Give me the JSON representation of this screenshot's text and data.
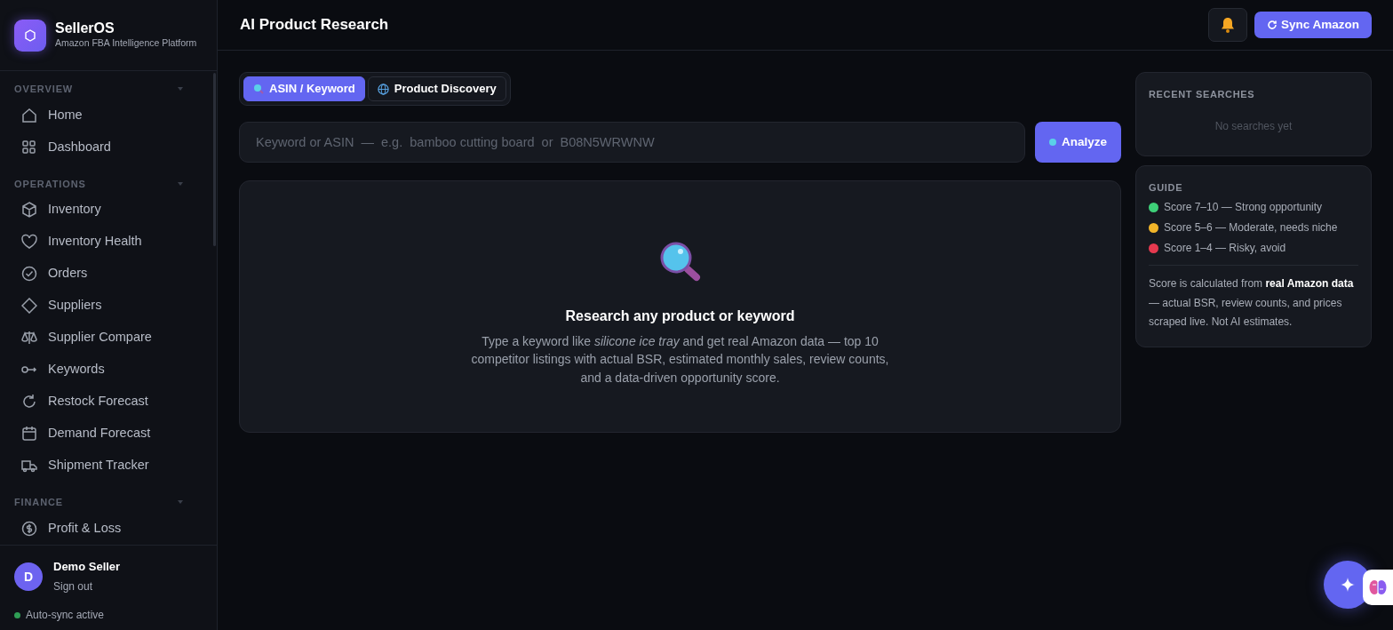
{
  "brand": {
    "name": "SellerOS",
    "tagline": "Amazon FBA Intelligence Platform"
  },
  "sidebar": {
    "sections": [
      {
        "title": "OVERVIEW",
        "expanded": true,
        "items": [
          {
            "label": "Home",
            "selected": false
          },
          {
            "label": "Dashboard",
            "selected": false
          }
        ]
      },
      {
        "title": "OPERATIONS",
        "expanded": true,
        "items": [
          {
            "label": "Inventory",
            "selected": false
          },
          {
            "label": "Inventory Health",
            "selected": false
          },
          {
            "label": "Orders",
            "selected": false
          },
          {
            "label": "Suppliers",
            "selected": false
          },
          {
            "label": "Supplier Compare",
            "selected": false
          },
          {
            "label": "Keywords",
            "selected": false
          },
          {
            "label": "Restock Forecast",
            "selected": false
          },
          {
            "label": "Demand Forecast",
            "selected": false
          },
          {
            "label": "Shipment Tracker",
            "selected": false
          }
        ]
      },
      {
        "title": "FINANCE",
        "expanded": true,
        "items": [
          {
            "label": "Profit & Loss",
            "selected": false
          }
        ]
      }
    ]
  },
  "user": {
    "initial": "D",
    "name": "Demo Seller",
    "action": "Sign out"
  },
  "sync_status": {
    "label": "Auto-sync active",
    "on": true
  },
  "header": {
    "title": "AI Product Research",
    "sync_button": "Sync Amazon"
  },
  "tabs": [
    {
      "label": "ASIN / Keyword",
      "selected": true
    },
    {
      "label": "Product Discovery",
      "selected": false
    }
  ],
  "search": {
    "placeholder": "Keyword or ASIN  —  e.g.  bamboo cutting board  or  B08N5WRWNW",
    "button": "Analyze"
  },
  "empty_state": {
    "title": "Research any product or keyword",
    "text": "Type a keyword like *silicone ice tray* and get real Amazon data — top 10 competitor listings with actual BSR, estimated monthly sales, review counts, and a data-driven opportunity score."
  },
  "recent_searches": {
    "title": "RECENT SEARCHES",
    "empty": "No searches yet"
  },
  "guide": {
    "title": "GUIDE",
    "items": [
      {
        "label": "Score 7–10 — Strong opportunity",
        "color": "#3ecf78"
      },
      {
        "label": "Score 5–6 — Moderate, needs niche",
        "color": "#f0b429"
      },
      {
        "label": "Score 1–4 — Risky, avoid",
        "color": "#e5394f"
      }
    ],
    "note": "Score is calculated from **real Amazon data** — actual BSR, review counts, and prices scraped live. Not AI estimates."
  }
}
